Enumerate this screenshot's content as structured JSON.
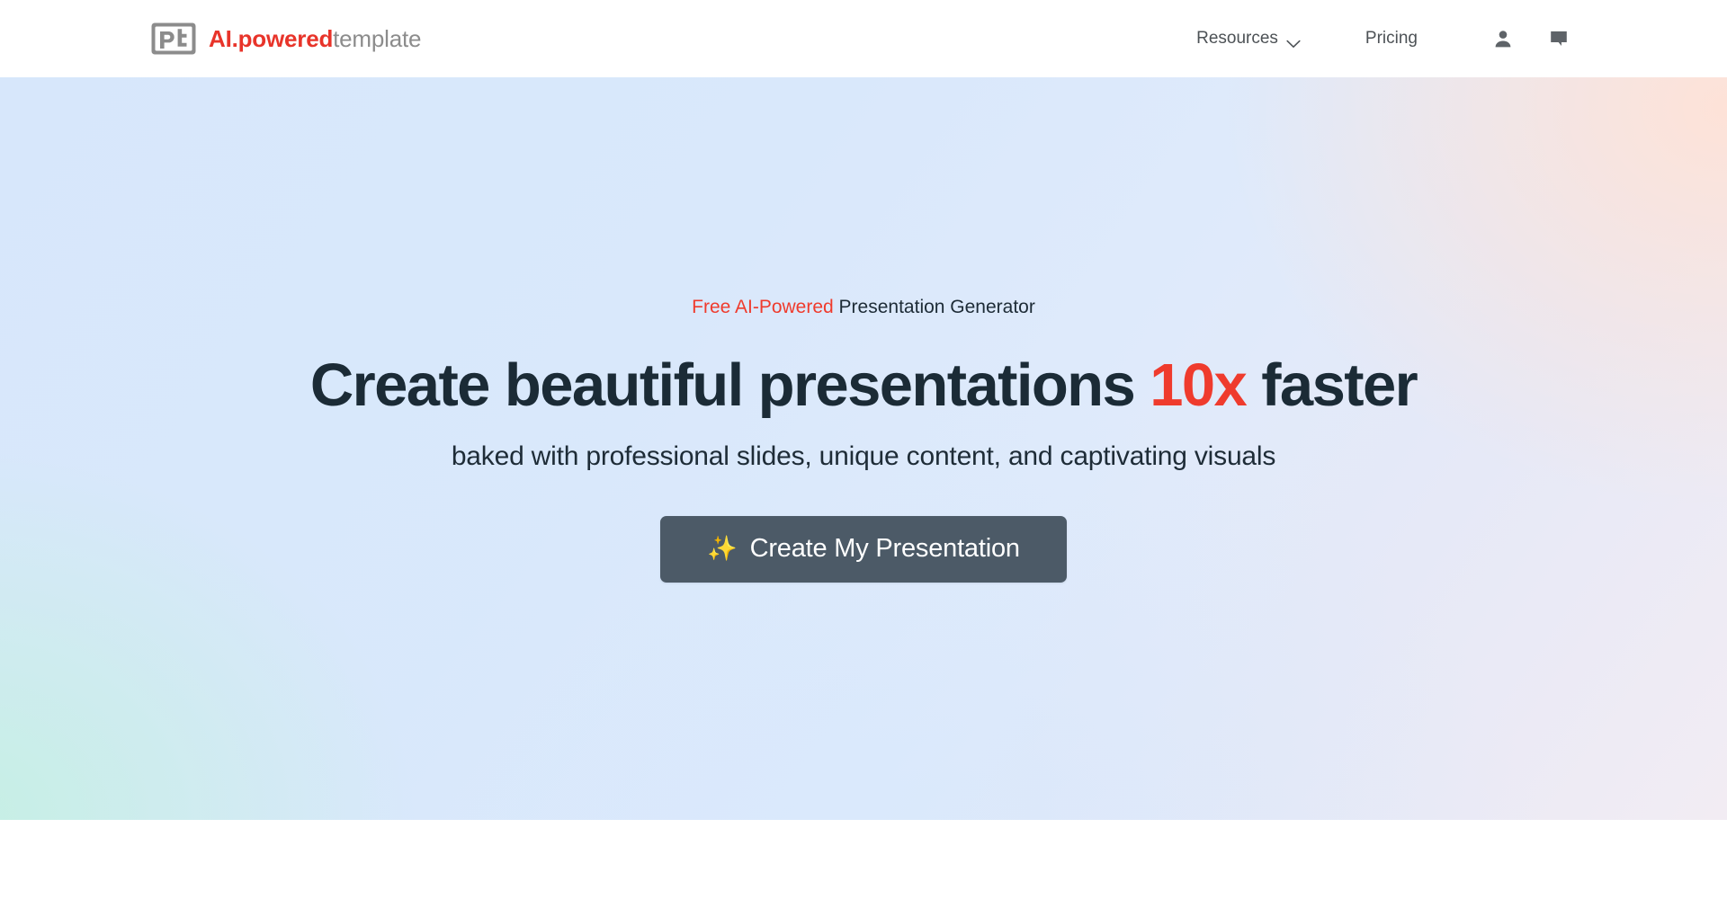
{
  "header": {
    "logo": {
      "mark_text": "pt",
      "mark_color": "#8c8c8c",
      "text_part1": "AI.",
      "text_part2": "powered",
      "text_part3": "template",
      "accent_color": "#e8342a",
      "muted_color": "#8c8c8c"
    },
    "nav": {
      "resources_label": "Resources",
      "pricing_label": "Pricing",
      "resources_icon": "chevron-down-icon",
      "account_icon": "user-account-icon",
      "chat_icon": "chat-bubble-icon"
    }
  },
  "hero": {
    "eyebrow_highlight": "Free AI-Powered",
    "eyebrow_rest": " Presentation Generator",
    "headline_part1": "Create beautiful presentations ",
    "headline_highlight": "10x",
    "headline_part2": " faster",
    "subheadline": "baked with professional slides, unique content, and captivating visuals",
    "cta_label": "Create My Presentation",
    "cta_icon": "sparkles-icon",
    "cta_icon_glyph": "✨",
    "colors": {
      "accent_red": "#ef3b2d",
      "headline_dark": "#1b2b36",
      "cta_background": "#4c5a67",
      "cta_text": "#ffffff",
      "gradient_top_left": "#d7e7fb",
      "gradient_top_right": "#fbf0ec",
      "gradient_bottom_left": "#dcf2ec",
      "gradient_bottom_right": "#d8e7fa"
    }
  }
}
